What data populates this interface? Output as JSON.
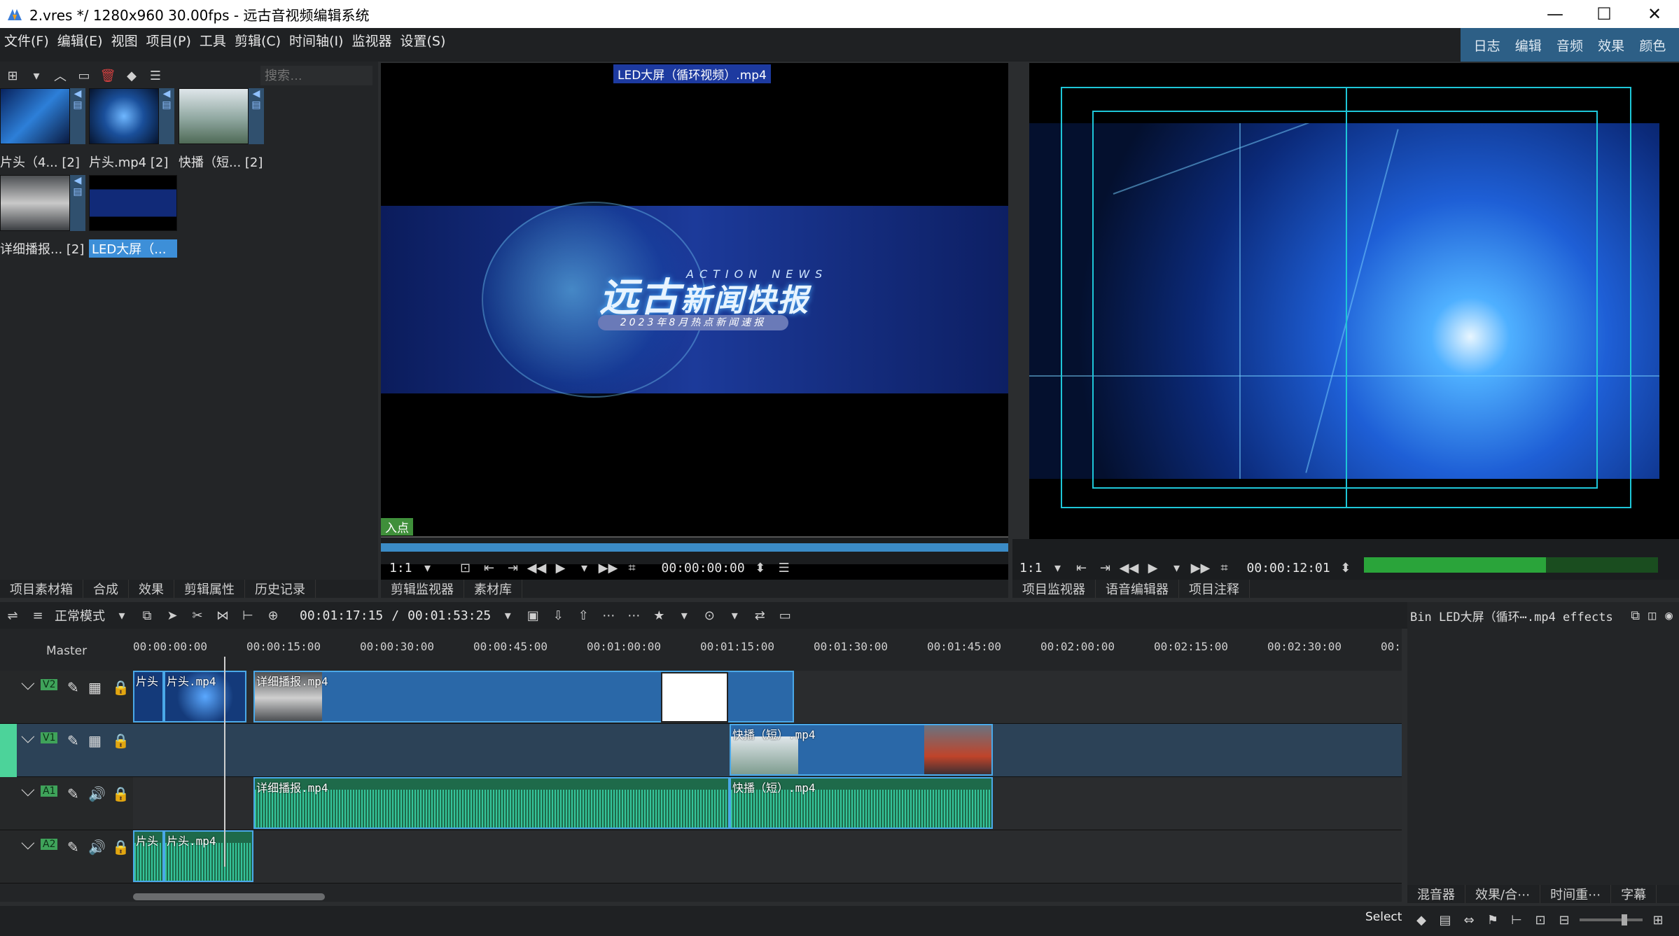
{
  "window": {
    "title": "2.vres */ 1280x960 30.00fps - 远古音视频编辑系统",
    "minimize_icon": "minimize-icon",
    "maximize_icon": "maximize-icon",
    "close_icon": "close-icon"
  },
  "menu": [
    "文件(F)",
    "编辑(E)",
    "视图",
    "项目(P)",
    "工具",
    "剪辑(C)",
    "时间轴(I)",
    "监视器",
    "设置(S)"
  ],
  "workspace_tabs": [
    "日志",
    "编辑",
    "音频",
    "效果",
    "颜色"
  ],
  "bin": {
    "search_placeholder": "搜索…",
    "clips": [
      {
        "label": "片头（4... [2]",
        "selected": false
      },
      {
        "label": "片头.mp4 [2]",
        "selected": false
      },
      {
        "label": "快播（短... [2]",
        "selected": false
      },
      {
        "label": "详细播报... [2]",
        "selected": false
      },
      {
        "label": "LED大屏（...",
        "selected": true
      }
    ],
    "tabs": [
      "项目素材箱",
      "合成",
      "效果",
      "剪辑属性",
      "历史记录"
    ]
  },
  "clip_monitor": {
    "clip_name": "LED大屏（循环视频）.mp4",
    "video_title": "远古",
    "video_title2": "新闻快报",
    "video_action": "ACTION NEWS",
    "video_sub": "2023年8月热点新闻速报",
    "in_point": "入点",
    "zoom": "1:1",
    "timecode": "00:00:00:00",
    "tabs": [
      "剪辑监视器",
      "素材库"
    ]
  },
  "project_monitor": {
    "zoom": "1:1",
    "timecode": "00:00:12:01",
    "tabs": [
      "项目监视器",
      "语音编辑器",
      "项目注释"
    ],
    "vu_level": 0.62
  },
  "timeline": {
    "mode": "正常模式",
    "position": "00:01:17:15",
    "duration": "00:01:53:25",
    "master_label": "Master",
    "ruler": [
      "00:00:00:00",
      "00:00:15:00",
      "00:00:30:00",
      "00:00:45:00",
      "00:01:00:00",
      "00:01:15:00",
      "00:01:30:00",
      "00:01:45:00",
      "00:02:00:00",
      "00:02:15:00",
      "00:02:30:00",
      "00:"
    ],
    "tracks": [
      {
        "tag": "V2",
        "type": "video"
      },
      {
        "tag": "V1",
        "type": "video"
      },
      {
        "tag": "A1",
        "type": "audio"
      },
      {
        "tag": "A2",
        "type": "audio"
      }
    ],
    "clips": {
      "v2_a": "片头",
      "v2_b": "片头.mp4",
      "v2_c": "详细播报.mp4",
      "v1_a": "快播（短）.mp4",
      "a1_a": "详细播报.mp4",
      "a1_b": "快播（短）.mp4",
      "a2_a": "片头",
      "a2_b": "片头.mp4"
    }
  },
  "effects_panel": {
    "header": "Bin LED大屏（循环⋯.mp4 effects",
    "tabs": [
      "混音器",
      "效果/合⋯",
      "时间重⋯",
      "字幕"
    ]
  },
  "status": {
    "select_label": "Select"
  }
}
